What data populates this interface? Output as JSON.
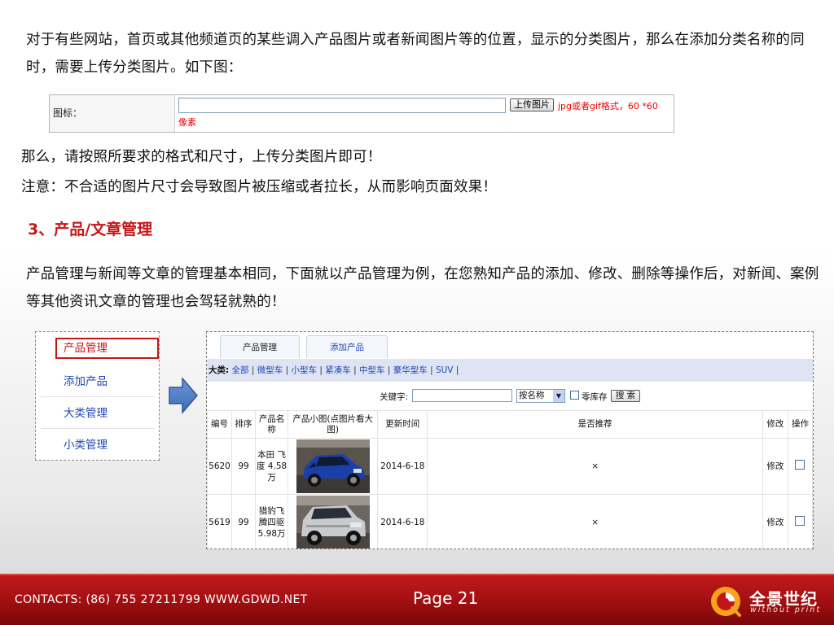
{
  "intro": "对于有些网站，首页或其他频道页的某些调入产品图片或者新闻图片等的位置，显示的分类图片，那么在添加分类名称的同时，需要上传分类图片。如下图：",
  "upload": {
    "label": "图标：",
    "button": "上传图片",
    "hint": "jpg或者gif格式，60 *60",
    "hint2": "像素"
  },
  "line3": "那么，请按照所要求的格式和尺寸，上传分类图片即可！",
  "line4": "注意：不合适的图片尺寸会导致图片被压缩或者拉长，从而影响页面效果！",
  "section_heading": "3、产品/文章管理",
  "body": "产品管理与新闻等文章的管理基本相同，下面就以产品管理为例，在您熟知产品的添加、修改、删除等操作后，对新闻、案例等其他资讯文章的管理也会驾轻就熟的！",
  "side_menu": [
    "产品管理",
    "添加产品",
    "大类管理",
    "小类管理"
  ],
  "admin": {
    "tabs": [
      "产品管理",
      "添加产品"
    ],
    "category_label": "大类:",
    "categories": [
      "全部",
      "微型车",
      "小型车",
      "紧凑车",
      "中型车",
      "豪华型车",
      "SUV"
    ],
    "keyword_label": "关键字:",
    "select_value": "按名称",
    "stock_label": "零库存",
    "search_button": "搜 索",
    "columns": [
      "编号",
      "排序",
      "产品名称",
      "产品小图(点图片看大图)",
      "更新时间",
      "是否推荐",
      "修改",
      "操作"
    ],
    "rows": [
      {
        "id": "5620",
        "sort": "99",
        "name": "本田 飞度 4.58万",
        "date": "2014-6-18",
        "recommend": "×",
        "edit": "修改"
      },
      {
        "id": "5619",
        "sort": "99",
        "name": "猎豹飞腾四驱5.98万",
        "date": "2014-6-18",
        "recommend": "×",
        "edit": "修改"
      }
    ]
  },
  "footer": {
    "contacts": "CONTACTS: (86) 755 27211799 WWW.GDWD.NET",
    "page": "Page 21",
    "logo_text": "全景世纪",
    "logo_slogan": "without print"
  },
  "colors": {
    "heading_red": "#c51616",
    "link_blue": "#1e47b7",
    "footer_red": "#a30f12"
  }
}
